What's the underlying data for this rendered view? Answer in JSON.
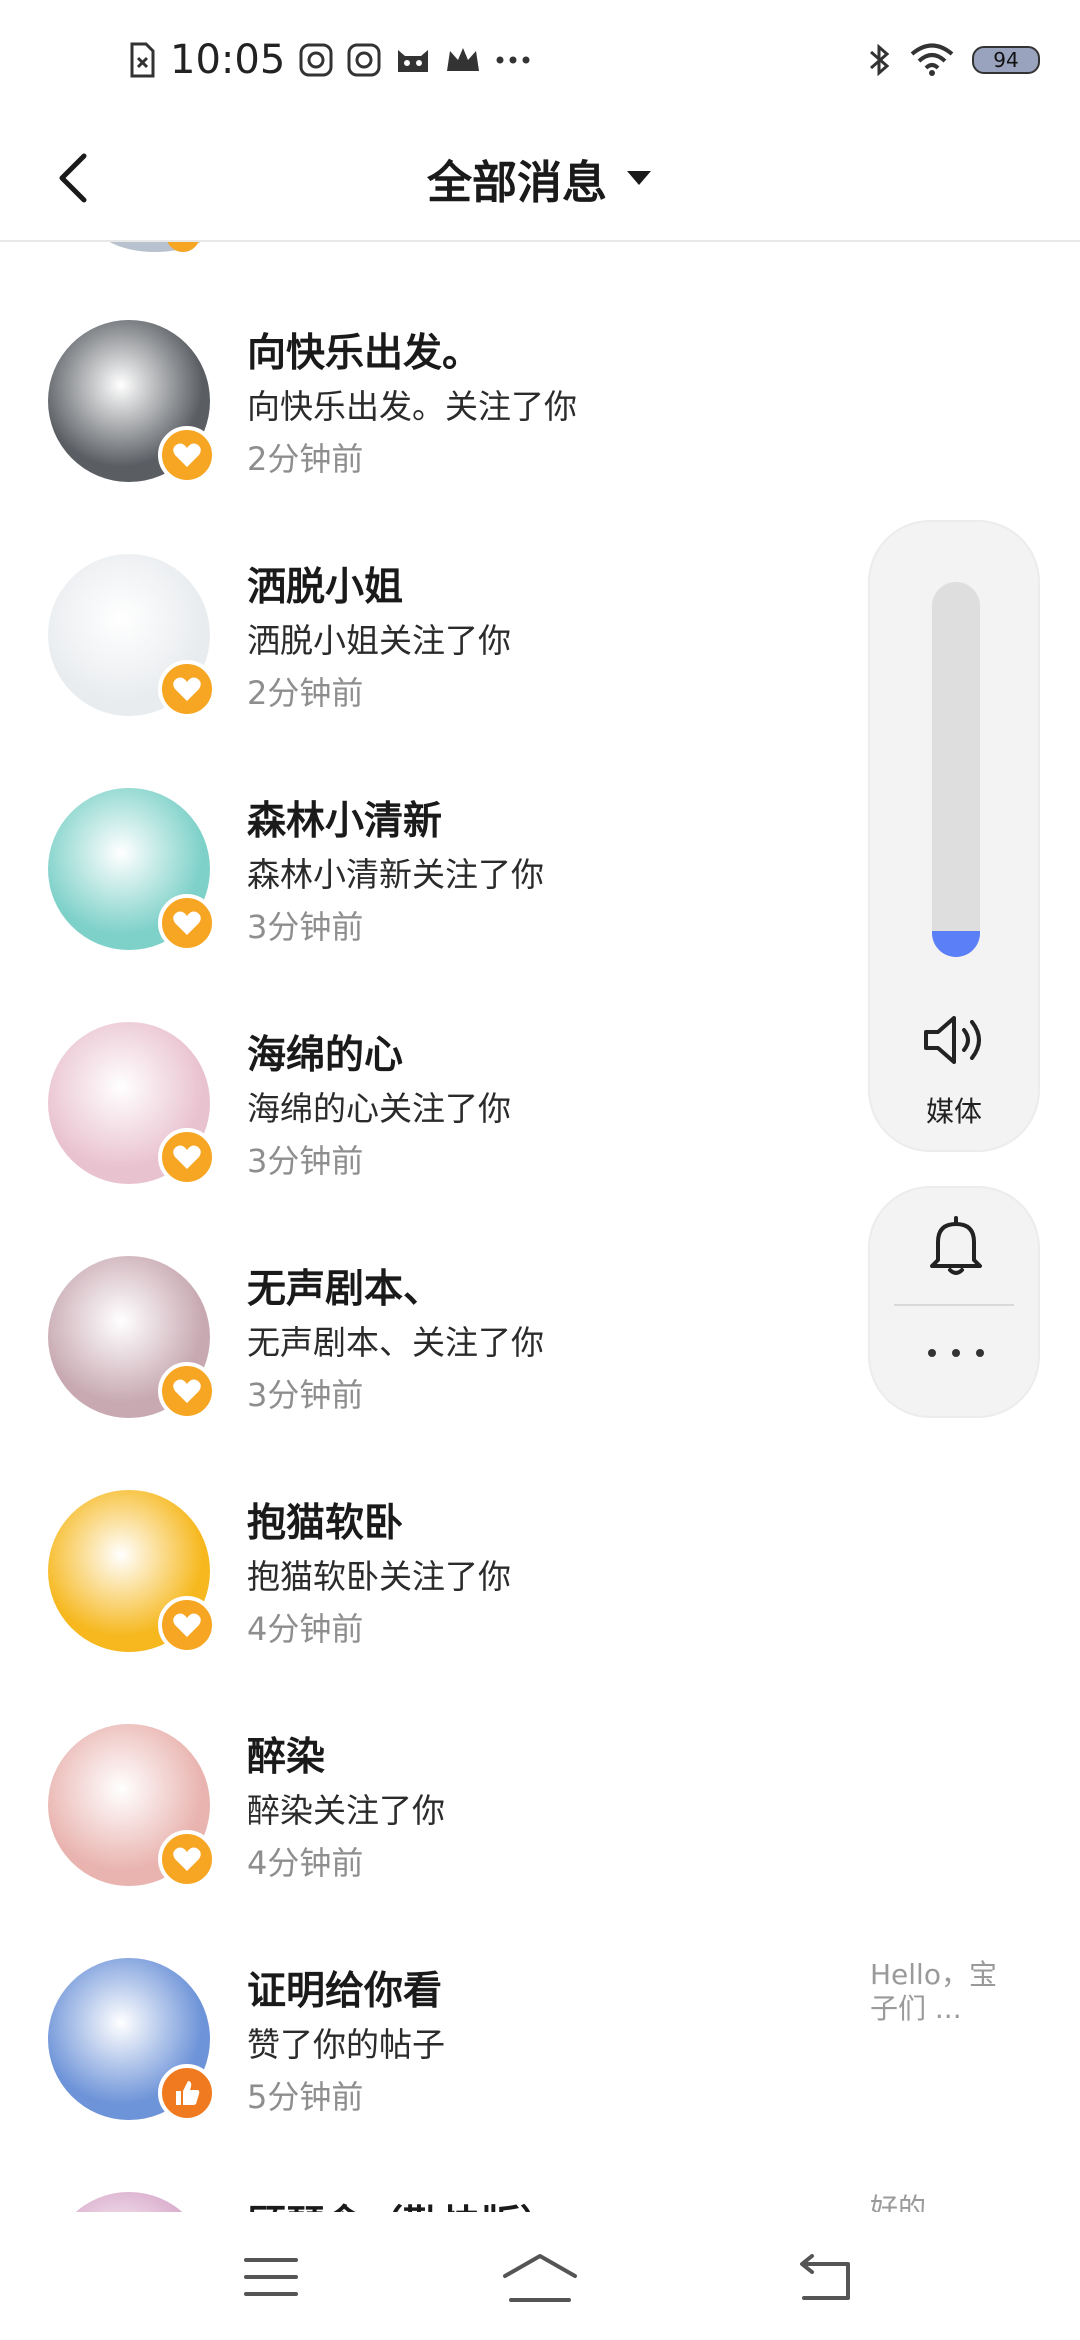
{
  "status_bar": {
    "time": "10:05",
    "left_icons": [
      "sim-off-icon",
      "notification-app-icon",
      "notification-app-icon",
      "cat-face-icon",
      "crown-icon",
      "more-dots-icon"
    ],
    "right_icons": [
      "bluetooth-icon",
      "wifi-icon"
    ],
    "battery": "94"
  },
  "header": {
    "title": "全部消息",
    "back_icon": "chevron-left-icon",
    "dropdown_icon": "caret-down-icon"
  },
  "messages": [
    {
      "name": "向快乐出发。",
      "action": "向快乐出发。关注了你",
      "time": "2分钟前",
      "badge": "heart",
      "avatar_color": "#5a5e63",
      "preview": ""
    },
    {
      "name": "洒脱小姐",
      "action": "洒脱小姐关注了你",
      "time": "2分钟前",
      "badge": "heart",
      "avatar_color": "#e9ecef",
      "preview": ""
    },
    {
      "name": "森林小清新",
      "action": "森林小清新关注了你",
      "time": "3分钟前",
      "badge": "heart",
      "avatar_color": "#7ed1c9",
      "preview": ""
    },
    {
      "name": "海绵的心",
      "action": "海绵的心关注了你",
      "time": "3分钟前",
      "badge": "heart",
      "avatar_color": "#e9c2d0",
      "preview": ""
    },
    {
      "name": "无声剧本、",
      "action": "无声剧本、关注了你",
      "time": "3分钟前",
      "badge": "heart",
      "avatar_color": "#c8a9b2",
      "preview": ""
    },
    {
      "name": "抱猫软卧",
      "action": "抱猫软卧关注了你",
      "time": "4分钟前",
      "badge": "heart",
      "avatar_color": "#f6b81e",
      "preview": ""
    },
    {
      "name": "醉染",
      "action": "醉染关注了你",
      "time": "4分钟前",
      "badge": "heart",
      "avatar_color": "#e9b4b0",
      "preview": ""
    },
    {
      "name": "证明给你看",
      "action": "赞了你的帖子",
      "time": "5分钟前",
      "badge": "thumb",
      "avatar_color": "#6d93d8",
      "preview": "Hello，宝子们 ..."
    },
    {
      "name": "顾琴念（勤快版）",
      "action": "",
      "time": "",
      "badge": "",
      "avatar_color": "#d7a7c9",
      "preview": "好的"
    }
  ],
  "volume_panel": {
    "level_percent": 7,
    "media_label": "媒体",
    "speaker_icon": "speaker-icon",
    "bell_icon": "bell-icon",
    "more_icon": "more-dots-icon"
  },
  "bottom_nav": {
    "menu_icon": "menu-icon",
    "home_icon": "home-icon",
    "back_icon": "back-icon"
  },
  "colors": {
    "heart_badge": "#f6a623",
    "thumb_badge": "#f07a1f",
    "volume_accent": "#5b7ff6",
    "secondary_text": "#8e8e8e"
  }
}
